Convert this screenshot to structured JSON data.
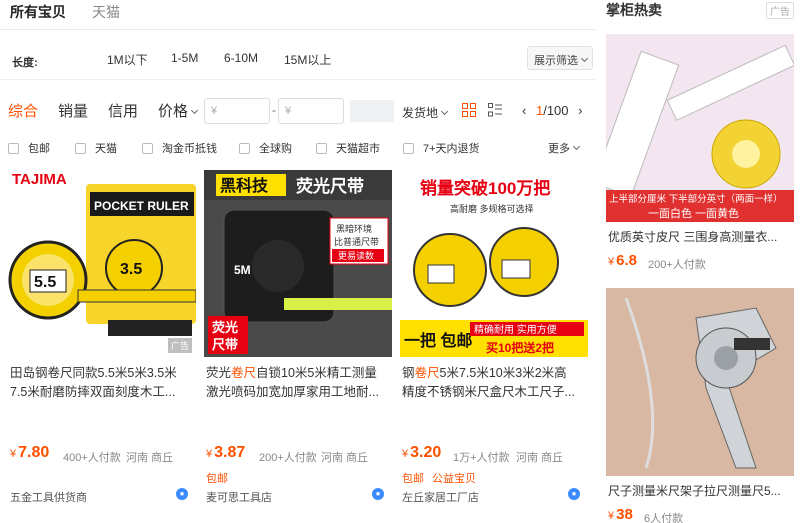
{
  "tabs": {
    "all": "所有宝贝",
    "tmall": "天猫"
  },
  "length_filter": {
    "label": "长度:",
    "options": [
      "1M以下",
      "1-5M",
      "6-10M",
      "15M以上"
    ],
    "expand_label": "展示筛选"
  },
  "sort": {
    "items": [
      "综合",
      "销量",
      "信用",
      "价格"
    ],
    "price_min_placeholder": "¥",
    "price_max_placeholder": "¥",
    "ship_from": "发货地",
    "pager_current": "1",
    "pager_total": "/100"
  },
  "checks": {
    "items": [
      "包邮",
      "天猫",
      "淘金币抵钱",
      "全球购",
      "天猫超市",
      "7+天内退货"
    ],
    "more": "更多"
  },
  "products": [
    {
      "title_before": "田岛钢卷尺同款5.5米5米3.5米",
      "title_line2": "7.5米耐磨防摔双面刻度木工...",
      "price": "7.80",
      "sales": "400+人付款",
      "location": "河南 商丘",
      "tag": "",
      "shop": "五金工具供货商",
      "img_brand": "TAJIMA",
      "img_label1": "POCKET RULER",
      "img_label2": "5.5",
      "img_label3": "3.5",
      "ad": "广告"
    },
    {
      "title_before": "荧光",
      "title_hl": "卷尺",
      "title_after": "自锁10米5米精工测量",
      "title_line2": "激光喷码加宽加厚家用工地耐...",
      "price": "3.87",
      "sales": "200+人付款",
      "location": "河南 商丘",
      "tag": "包邮",
      "shop": "麦可思工具店",
      "img_banner1": "黑科技",
      "img_banner2": "荧光尺带",
      "img_note1": "黑暗环境",
      "img_note2": "比普通尺带",
      "img_note3": "更易读数",
      "img_label": "5M",
      "img_corner1": "荧光",
      "img_corner2": "尺带"
    },
    {
      "title_before": "钢",
      "title_hl": "卷尺",
      "title_after": "5米7.5米10米3米2米高",
      "title_line2": "精度不锈钢米尺盒尺木工尺子...",
      "price": "3.20",
      "sales": "1万+人付款",
      "location": "河南 商丘",
      "tag": "包邮",
      "tag2": "公益宝贝",
      "shop": "左丘家居工厂店",
      "img_top": "销量突破100万把",
      "img_sub": "高耐磨 多规格可选择",
      "img_bottom1": "一把 包邮",
      "img_bottom2": "精确耐用 实用方便",
      "img_bottom3": "买10把送2把"
    }
  ],
  "sidebar": {
    "title": "掌柜热卖",
    "ad": "广告",
    "items": [
      {
        "banner_line1": "上半部分厘米 下半部分英寸（两面一样）",
        "banner_line2": "一面白色 一面黄色",
        "title": "优质英寸皮尺 三围身高测量衣...",
        "price": "6.8",
        "sales": "200+人付款"
      },
      {
        "title": "尺子测量米尺架子拉尺测量尺5...",
        "price": "38",
        "sales": "6人付款"
      }
    ]
  },
  "currency": "¥"
}
